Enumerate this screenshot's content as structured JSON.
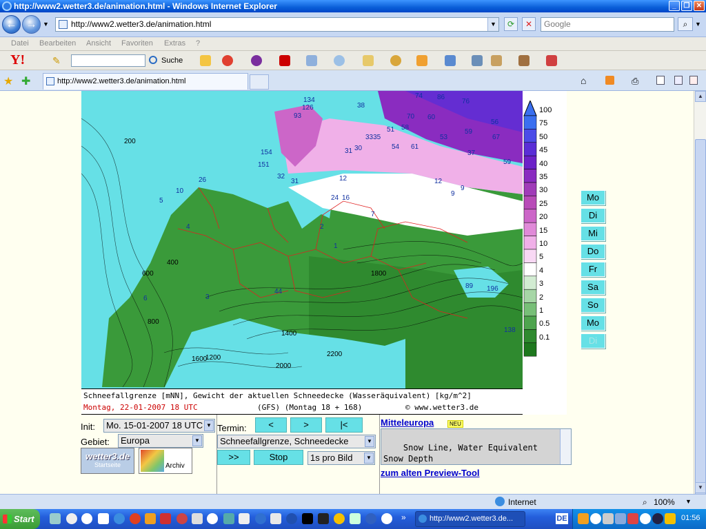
{
  "window": {
    "title": "http://www2.wetter3.de/animation.html - Windows Internet Explorer",
    "address": "http://www2.wetter3.de/animation.html",
    "search_placeholder": "Google",
    "tab_title": "http://www2.wetter3.de/animation.html"
  },
  "menu": [
    "Datei",
    "Bearbeiten",
    "Ansicht",
    "Favoriten",
    "Extras",
    "?"
  ],
  "toolbar": {
    "search_button": "Suche"
  },
  "map": {
    "caption_line1": "Schneefallgrenze [mNN], Gewicht der aktuellen Schneedecke (Wasseräquivalent) [kg/m^2]",
    "caption_date": "Montag, 22-01-2007  18 UTC",
    "caption_model": "(GFS)  (Montag 18 + 168)",
    "caption_site": "© www.wetter3.de",
    "labels": [
      {
        "t": "134"
      },
      {
        "t": "126"
      },
      {
        "t": "93"
      },
      {
        "t": "74"
      },
      {
        "t": "86"
      },
      {
        "t": "76"
      },
      {
        "t": "38"
      },
      {
        "t": "70"
      },
      {
        "t": "60"
      },
      {
        "t": "51"
      },
      {
        "t": "58"
      },
      {
        "t": "3335"
      },
      {
        "t": "53"
      },
      {
        "t": "59"
      },
      {
        "t": "56"
      },
      {
        "t": "67"
      },
      {
        "t": "54"
      },
      {
        "t": "61"
      },
      {
        "t": "31"
      },
      {
        "t": "30"
      },
      {
        "t": "37"
      },
      {
        "t": "59"
      },
      {
        "t": "154"
      },
      {
        "t": "151"
      },
      {
        "t": "12"
      },
      {
        "t": "12"
      },
      {
        "t": "9"
      },
      {
        "t": "9"
      },
      {
        "t": "32"
      },
      {
        "t": "31"
      },
      {
        "t": "24"
      },
      {
        "t": "16"
      },
      {
        "t": "26"
      },
      {
        "t": "10"
      },
      {
        "t": "200"
      },
      {
        "t": "400"
      },
      {
        "t": "600"
      },
      {
        "t": "800"
      },
      {
        "t": "1200"
      },
      {
        "t": "1400"
      },
      {
        "t": "1600"
      },
      {
        "t": "1800"
      },
      {
        "t": "2000"
      },
      {
        "t": "2200"
      },
      {
        "t": "196"
      },
      {
        "t": "89"
      },
      {
        "t": "138"
      },
      {
        "t": "44"
      },
      {
        "t": "5"
      },
      {
        "t": "4"
      },
      {
        "t": "6"
      },
      {
        "t": "2"
      },
      {
        "t": "3"
      },
      {
        "t": "7"
      },
      {
        "t": "1"
      }
    ]
  },
  "legend": {
    "ticks": [
      "100",
      "75",
      "50",
      "45",
      "40",
      "35",
      "30",
      "25",
      "20",
      "15",
      "10",
      "5",
      "4",
      "3",
      "2",
      "1",
      "0.5",
      "0.1"
    ],
    "colors": [
      "#3a6ff0",
      "#4b4ce8",
      "#5a2ed6",
      "#6c22c8",
      "#8a2cc0",
      "#a03cb8",
      "#b84cb8",
      "#cc66c8",
      "#e08ad8",
      "#f0b0e8",
      "#f8d8f4",
      "#ffffff",
      "#d2ecd2",
      "#a6d6a6",
      "#78bf78",
      "#4ea44e",
      "#2f8a2f",
      "#1e781e"
    ]
  },
  "days": [
    {
      "label": "Mo",
      "enabled": true
    },
    {
      "label": "Di",
      "enabled": true
    },
    {
      "label": "Mi",
      "enabled": true
    },
    {
      "label": "Do",
      "enabled": true
    },
    {
      "label": "Fr",
      "enabled": true
    },
    {
      "label": "Sa",
      "enabled": true
    },
    {
      "label": "So",
      "enabled": true
    },
    {
      "label": "Mo",
      "enabled": true
    },
    {
      "label": "Di",
      "enabled": false
    }
  ],
  "controls": {
    "init_label": "Init:",
    "init_value": "Mo. 15-01-2007 18 UTC",
    "gebiet_label": "Gebiet:",
    "gebiet_value": "Europa",
    "termin_label": "Termin:",
    "btn_prev": "<",
    "btn_next": ">",
    "btn_first": "|<",
    "product_value": "Schneefallgrenze, Schneedecke",
    "btn_play": ">>",
    "btn_stop": "Stop",
    "speed_value": "1s pro Bild",
    "startseite_logo": "wetter3.de",
    "startseite_label": "Startseite",
    "archiv_label": "Archiv",
    "region_link": "Mitteleuropa",
    "neu_badge": "NEU",
    "info_text": "Snow Line, Water Equivalent\nSnow Depth",
    "preview_link": "zum alten Preview-Tool"
  },
  "status": {
    "zone": "Internet",
    "zoom": "100%"
  },
  "taskbar": {
    "start": "Start",
    "item": "http://www2.wetter3.de...",
    "lang": "DE",
    "clock": "01:56"
  }
}
